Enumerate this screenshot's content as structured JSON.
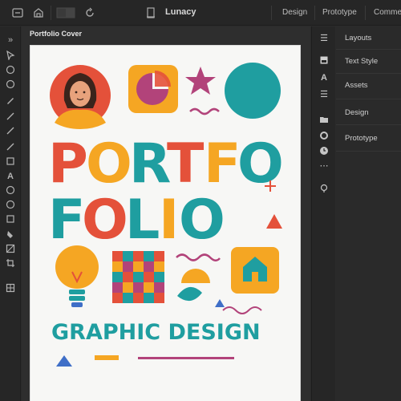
{
  "app": {
    "title": "Lunacy"
  },
  "top_tabs": [
    "Design",
    "Prototype",
    "Comme"
  ],
  "frame": {
    "label": "Portfolio Cover"
  },
  "right_panel": {
    "items": [
      "Layouts",
      "Text Style",
      "Assets",
      "Design",
      "Prototype"
    ]
  },
  "poster": {
    "line1": [
      "P",
      "O",
      "R",
      "T",
      "F",
      "O"
    ],
    "line2": [
      "F",
      "O",
      "L",
      "I",
      "O"
    ],
    "subtitle": "GRAPHIC DESIGN"
  },
  "colors": {
    "red": "#e4513a",
    "orange": "#f5a623",
    "teal": "#1f9ea0",
    "purple": "#b2437a",
    "blue": "#3f6fc7",
    "ui_bg": "#2b2b2b"
  },
  "icons": {
    "top": [
      "frame-toggle-icon",
      "home-icon",
      "layout-icon",
      "refresh-icon",
      "document-icon"
    ],
    "left": [
      "pointer-icon",
      "ellipse-icon",
      "circle-icon",
      "pen-icon",
      "line-icon",
      "pencil-icon",
      "line2-icon",
      "rectangle-icon",
      "text-icon",
      "ellipse2-icon",
      "circle2-icon",
      "square-icon",
      "fill-icon",
      "image-icon",
      "crop-icon",
      "grid-icon"
    ],
    "right": [
      "menu-icon",
      "square-icon",
      "text-icon",
      "list-icon",
      "folder-icon",
      "circle-icon",
      "clock-icon",
      "more-icon",
      "bulb-icon"
    ]
  }
}
